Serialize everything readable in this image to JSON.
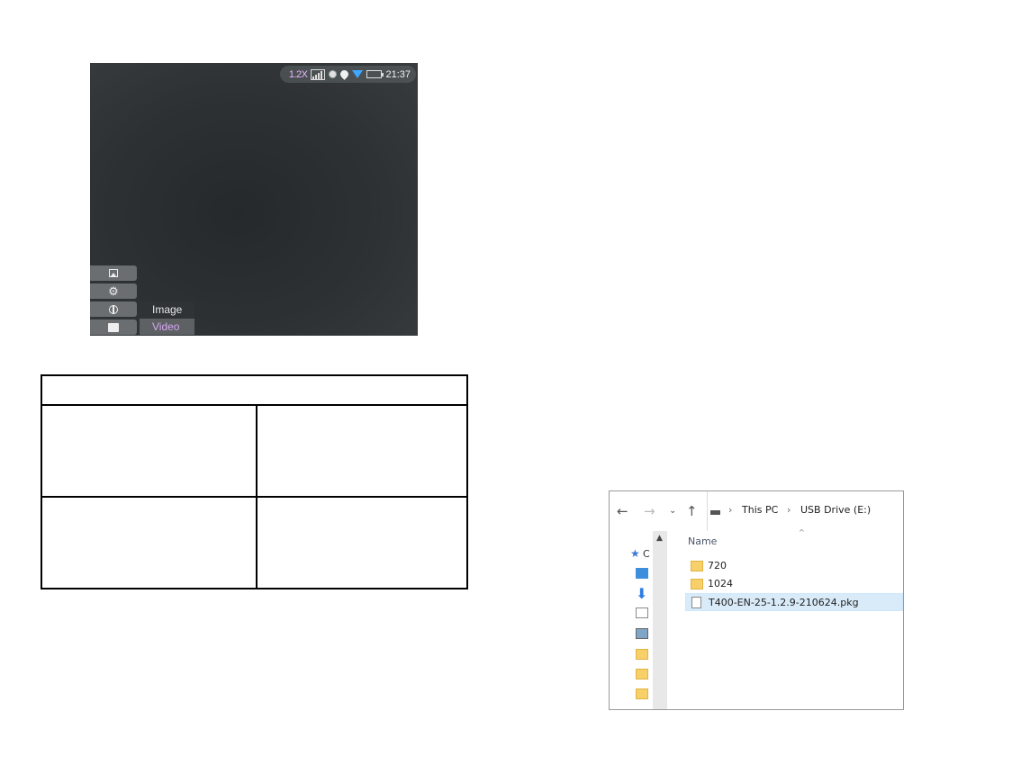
{
  "device_screen": {
    "status": {
      "zoom": "1.2X",
      "time": "21:37"
    },
    "menu": [
      {
        "icon": "gallery-icon"
      },
      {
        "icon": "gear-icon"
      },
      {
        "icon": "globe-icon"
      },
      {
        "icon": "folder-icon"
      }
    ],
    "submenu": {
      "image_label": "Image",
      "video_label": "Video"
    },
    "colors": {
      "selected_text": "#d9a6f5",
      "wifi": "#3ea7ff"
    }
  },
  "table": {
    "rows": 3
  },
  "explorer": {
    "breadcrumb": [
      "This PC",
      "USB Drive (E:)"
    ],
    "left_pane_quick_access": "C",
    "column_header": "Name",
    "files": [
      {
        "type": "folder",
        "name": "720"
      },
      {
        "type": "folder",
        "name": "1024"
      },
      {
        "type": "file",
        "name": "T400-EN-25-1.2.9-210624.pkg",
        "selected": true
      }
    ]
  }
}
